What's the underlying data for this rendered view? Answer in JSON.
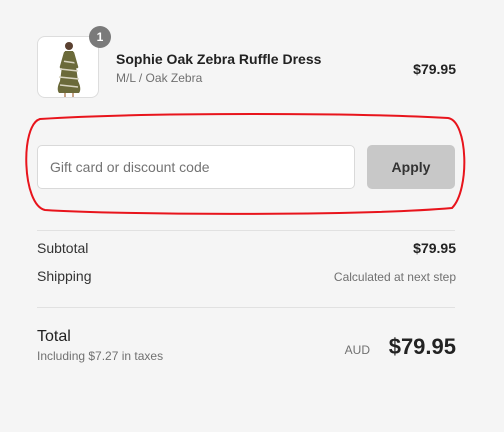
{
  "product": {
    "quantity": "1",
    "name": "Sophie Oak Zebra Ruffle Dress",
    "variant": "M/L / Oak Zebra",
    "price": "$79.95",
    "image_icon": "dress-photo"
  },
  "discount": {
    "placeholder": "Gift card or discount code",
    "value": "",
    "apply_label": "Apply",
    "highlight_color": "#e8141c"
  },
  "summary": {
    "subtotal_label": "Subtotal",
    "subtotal_value": "$79.95",
    "shipping_label": "Shipping",
    "shipping_value": "Calculated at next step"
  },
  "total": {
    "label": "Total",
    "tax_note": "Including $7.27 in taxes",
    "currency": "AUD",
    "amount": "$79.95"
  }
}
